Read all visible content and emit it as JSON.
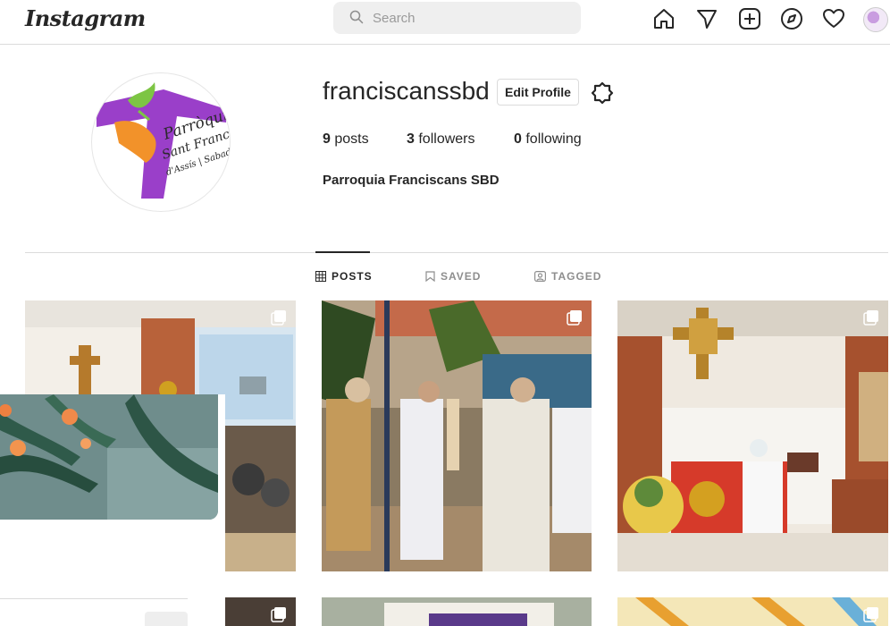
{
  "app": {
    "logo": "Instagram"
  },
  "search": {
    "placeholder": "Search"
  },
  "profile": {
    "username": "franciscanssbd",
    "edit_label": "Edit Profile",
    "posts_count": "9",
    "posts_label": "posts",
    "followers_count": "3",
    "followers_label": "followers",
    "following_count": "0",
    "following_label": "following",
    "full_name": "Parroquia Franciscans SBD",
    "logo_text": [
      "Parròquia",
      "Sant Francesc",
      "d'Assís | Sabadell"
    ]
  },
  "tabs": [
    {
      "label": "POSTS",
      "icon": "grid-icon",
      "active": true
    },
    {
      "label": "SAVED",
      "icon": "bookmark-icon",
      "active": false
    },
    {
      "label": "TAGGED",
      "icon": "tag-icon",
      "active": false
    }
  ],
  "nav_icons": [
    "home-icon",
    "direct-icon",
    "new-post-icon",
    "explore-icon",
    "activity-icon",
    "profile-avatar"
  ],
  "colors": {
    "accent": "#262626",
    "border": "#dbdbdb",
    "muted": "#8e8e8e",
    "brand_purple": "#8e3bbf",
    "brand_green": "#7cc444",
    "brand_orange": "#f08a24"
  }
}
